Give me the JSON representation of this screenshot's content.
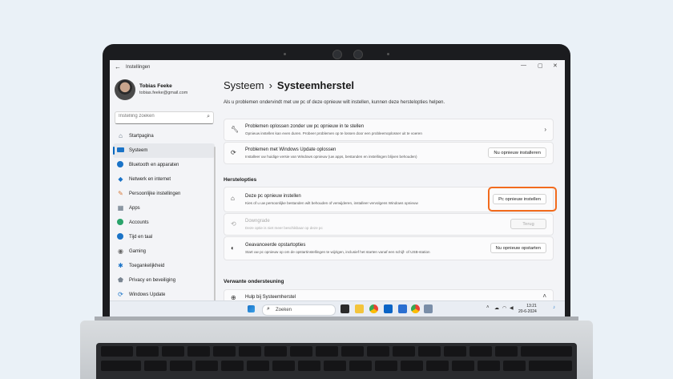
{
  "window": {
    "title": "Instellingen",
    "back": "←",
    "minimize": "—",
    "maximize": "▢",
    "close": "✕"
  },
  "user": {
    "name": "Tobias Feeke",
    "email": "tobias.feeke@gmail.com"
  },
  "search": {
    "placeholder": "Instelling zoeken"
  },
  "nav": {
    "items": [
      {
        "label": "Startpagina",
        "icon": "home-icon"
      },
      {
        "label": "Systeem",
        "icon": "monitor-icon",
        "active": true
      },
      {
        "label": "Bluetooth en apparaten",
        "icon": "bluetooth-icon"
      },
      {
        "label": "Netwerk en internet",
        "icon": "wifi-icon"
      },
      {
        "label": "Persoonlijke instellingen",
        "icon": "brush-icon"
      },
      {
        "label": "Apps",
        "icon": "apps-icon"
      },
      {
        "label": "Accounts",
        "icon": "person-icon"
      },
      {
        "label": "Tijd en taal",
        "icon": "globe-clock-icon"
      },
      {
        "label": "Gaming",
        "icon": "gamepad-icon"
      },
      {
        "label": "Toegankelijkheid",
        "icon": "accessibility-icon"
      },
      {
        "label": "Privacy en beveiliging",
        "icon": "shield-icon"
      },
      {
        "label": "Windows Update",
        "icon": "update-icon"
      }
    ]
  },
  "main": {
    "breadcrumb_parent": "Systeem",
    "breadcrumb_sep": "›",
    "breadcrumb_current": "Systeemherstel",
    "description": "Als u problemen ondervindt met uw pc of deze opnieuw wilt instellen, kunnen deze herstelopties helpen.",
    "card1": {
      "title": "Problemen oplossen zonder uw pc opnieuw in te stellen",
      "subtitle": "Opnieuw instellen kan even duren. Probeer problemen op te lossen door een probleemoplosser uit te voeren"
    },
    "card2": {
      "title": "Problemen met Windows Update oplossen",
      "subtitle": "Installeer uw huidige versie van Windows opnieuw (uw apps, bestanden en instellingen blijven behouden)",
      "button": "Nu opnieuw installeren"
    },
    "recovery_header": "Herstelopties",
    "reset": {
      "title": "Deze pc opnieuw instellen",
      "subtitle": "Kies of u uw persoonlijke bestanden wilt behouden of verwijderen, installeer vervolgens Windows opnieuw",
      "button": "Pc opnieuw instellen"
    },
    "downgrade": {
      "title": "Downgrade",
      "subtitle": "Deze optie is niet meer beschikbaar op deze pc",
      "button": "Terug"
    },
    "advanced": {
      "title": "Geavanceerde opstartopties",
      "subtitle": "Start uw pc opnieuw op om de opstartinstellingen te wijzigen, inclusief het starten vanaf een schijf- of USB-station",
      "button": "Nu opnieuw opstarten"
    },
    "related_header": "Verwante ondersteuning",
    "help": {
      "title": "Hulp bij Systeemherstel"
    }
  },
  "taskbar": {
    "search_label": "Zoeken",
    "time": "13:21",
    "date": "20-6-2024"
  },
  "colors": {
    "accent": "#0067c0",
    "highlight": "#f26b1d"
  }
}
